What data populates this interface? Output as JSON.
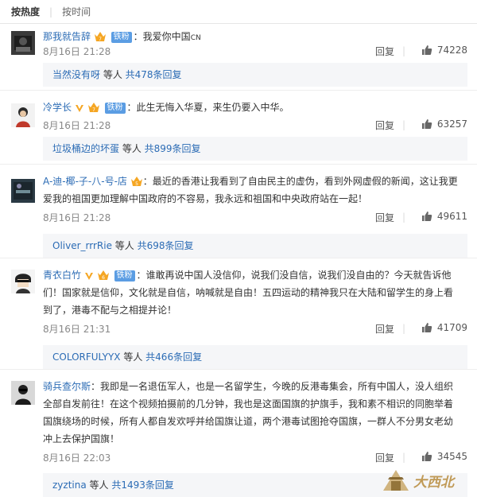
{
  "sort": {
    "hot": "按热度",
    "time": "按时间"
  },
  "comments": [
    {
      "user": "那我就告辞",
      "fan_badge": "铁粉",
      "text": "：我爱你中国",
      "text_suffix": "CN",
      "time": "8月16日 21:28",
      "reply": "回复",
      "likes": "74228",
      "sub": {
        "user": "当然没有呀",
        "mid": " 等人 ",
        "total": "共478条回复"
      }
    },
    {
      "user": "冷学长",
      "fan_badge": "铁粉",
      "text": "：此生无悔入华夏，来生仍要入中华。",
      "time": "8月16日 21:28",
      "reply": "回复",
      "likes": "63257",
      "sub": {
        "user": "垃圾桶边的坏蛋",
        "mid": " 等人 ",
        "total": "共899条回复"
      }
    },
    {
      "user": "A-迪-椰-子-八-号-店",
      "text_line1": "：最近的香港让我看到了自由民主的虚伪，看到外网虚假的新闻，这让我更",
      "text_line2": "爱我的祖国更加理解中国政府的不容易，我永远和祖国和中央政府站在一起！",
      "time": "8月16日 21:28",
      "reply": "回复",
      "likes": "49611",
      "sub": {
        "user": "Oliver_rrrRie",
        "mid": " 等人 ",
        "total": "共698条回复"
      }
    },
    {
      "user": "青衣白竹",
      "fan_badge": "铁粉",
      "text_line1": "：谁敢再说中国人没信仰，说我们没自信，说我们没自由的？今天就告诉他",
      "text_line2": "们！国家就是信仰，文化就是自信，呐喊就是自由！五四运动的精神我只在大陆和留学生的身上看",
      "text_line3": "到了，港毒不配与之相提并论！",
      "time": "8月16日 21:31",
      "reply": "回复",
      "likes": "41709",
      "sub": {
        "user": "COLORFULYYX",
        "mid": " 等人 ",
        "total": "共466条回复"
      }
    },
    {
      "user": "骑兵查尔斯",
      "text_line1": "：我即是一名退伍军人，也是一名留学生，今晚的反港毒集会，所有中国人，没人组织",
      "text_line2": "全部自发前往！在这个视频拍摄前的几分钟，我也是这面国旗的护旗手，我和素不相识的同胞举着",
      "text_line3": "国旗绕场的时候，所有人都自发欢呼并给国旗让道，两个港毒试图抢夺国旗，一群人不分男女老幼",
      "text_line4": "冲上去保护国旗！",
      "time": "8月16日 22:03",
      "reply": "回复",
      "likes": "34545",
      "sub": {
        "user": "zyztina",
        "mid": " 等人 ",
        "total": "共1493条回复"
      }
    }
  ],
  "watermark": "大西北"
}
